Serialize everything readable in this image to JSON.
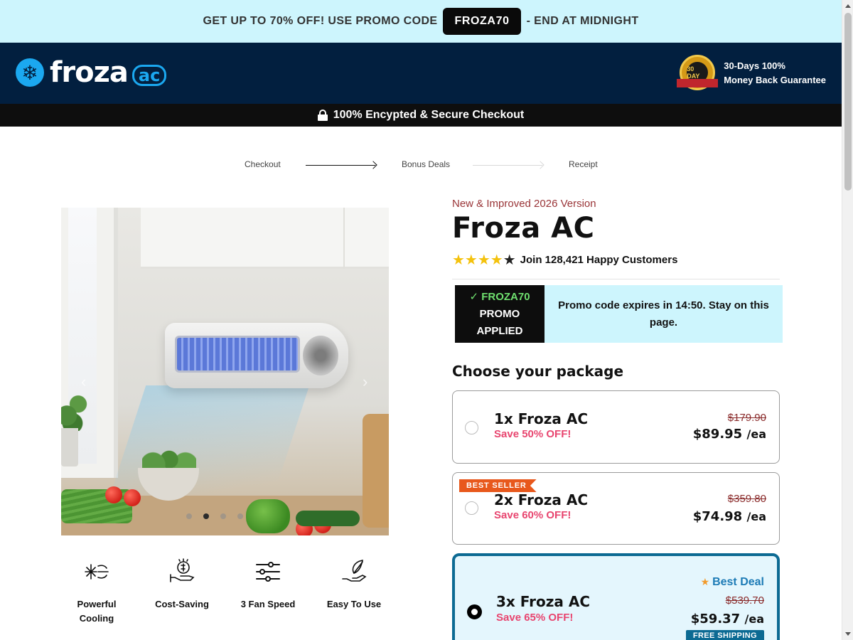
{
  "promo_bar": {
    "text_before": "GET UP TO 70% OFF! USE PROMO CODE",
    "code": "FROZA70",
    "text_after": "- END AT MIDNIGHT"
  },
  "header": {
    "logo_word": "froza",
    "logo_suffix": "ac",
    "seal_text": "30 DAY",
    "guarantee_line1": "30-Days 100%",
    "guarantee_line2": "Money Back Guarantee"
  },
  "secure_bar": {
    "text": "100% Encypted & Secure Checkout"
  },
  "steps": [
    {
      "label": "Checkout"
    },
    {
      "label": "Bonus Deals"
    },
    {
      "label": "Receipt"
    }
  ],
  "gallery": {
    "prev": "‹",
    "next": "›",
    "dot_count": 4,
    "active_dot": 2
  },
  "features": [
    {
      "label": "Powerful Cooling",
      "icon": "snowflake-wind-icon"
    },
    {
      "label": "Cost-Saving",
      "icon": "money-hand-icon"
    },
    {
      "label": "3 Fan Speed",
      "icon": "sliders-icon"
    },
    {
      "label": "Easy To Use",
      "icon": "hand-leaf-icon"
    }
  ],
  "product": {
    "tagline": "New & Improved 2026 Version",
    "title": "Froza AC",
    "rating_stars": 4.5,
    "rating_text": "Join 128,421 Happy Customers"
  },
  "promo_applied": {
    "code_line": "FROZA70",
    "line2": "PROMO",
    "line3": "APPLIED",
    "message": "Promo code expires in 14:50. Stay on this page."
  },
  "packages": {
    "heading": "Choose your package",
    "items": [
      {
        "name": "1x Froza AC",
        "save": "Save 50% OFF!",
        "old_price": "$179.90",
        "price": "$89.95",
        "per": "/ea",
        "selected": false
      },
      {
        "name": "2x Froza AC",
        "save": "Save 60% OFF!",
        "old_price": "$359.80",
        "price": "$74.98",
        "per": "/ea",
        "badge": "BEST SELLER",
        "selected": false
      },
      {
        "name": "3x Froza AC",
        "save": "Save 65% OFF!",
        "old_price": "$539.70",
        "price": "$59.37",
        "per": "/ea",
        "badge": "Best Deal",
        "shipping": "FREE SHIPPING",
        "selected": true
      }
    ]
  },
  "colors": {
    "promo_bg": "#cdf5fd",
    "header_bg": "#021f3f",
    "accent_blue": "#1ba8f0",
    "save_pink": "#e8456f",
    "selected_border": "#0c6a93",
    "badge_orange": "#e8581c"
  }
}
